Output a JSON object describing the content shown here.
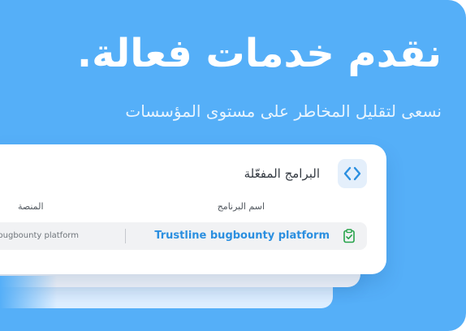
{
  "hero": {
    "headline": "نقدم خدمات فعالة.",
    "subline": "نسعى لتقليل المخاطر على مستوى المؤسسات"
  },
  "programs_card": {
    "title": "البرامج المفعّلة",
    "title_icon": "code-brackets-icon",
    "columns": {
      "program_name": "اسم البرنامج",
      "platform": "المنصة"
    },
    "rows": [
      {
        "status_icon": "clipboard-check-icon",
        "program_name": "Trustline bugbounty platform",
        "platform": "Trustline bugbounty platform"
      }
    ]
  },
  "colors": {
    "background": "#55aff8",
    "accent": "#2b8fe0",
    "status_green": "#27a34a"
  }
}
